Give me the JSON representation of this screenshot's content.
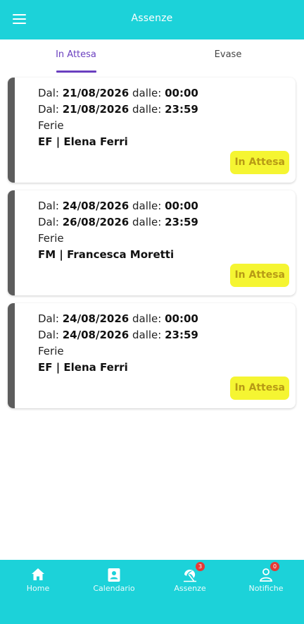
{
  "header": {
    "title": "Assenze"
  },
  "tabs": [
    {
      "label": "In Attesa"
    },
    {
      "label": "Evase"
    }
  ],
  "labels": {
    "dal": "Dal:",
    "dalle": "dalle:"
  },
  "requests": [
    {
      "start_date": "21/08/2026",
      "start_time": "00:00",
      "end_date": "21/08/2026",
      "end_time": "23:59",
      "type": "Ferie",
      "employee": "EF | Elena Ferri",
      "status": "In Attesa"
    },
    {
      "start_date": "24/08/2026",
      "start_time": "00:00",
      "end_date": "26/08/2026",
      "end_time": "23:59",
      "type": "Ferie",
      "employee": "FM | Francesca Moretti",
      "status": "In Attesa"
    },
    {
      "start_date": "24/08/2026",
      "start_time": "00:00",
      "end_date": "24/08/2026",
      "end_time": "23:59",
      "type": "Ferie",
      "employee": "EF | Elena Ferri",
      "status": "In Attesa"
    }
  ],
  "bottom_nav": [
    {
      "label": "Home",
      "icon": "home-icon"
    },
    {
      "label": "Calendario",
      "icon": "calendar-icon"
    },
    {
      "label": "Assenze",
      "icon": "beach-umbrella-icon",
      "badge": "3"
    },
    {
      "label": "Notifiche",
      "icon": "user-icon",
      "badge": "0"
    }
  ],
  "colors": {
    "primary": "#1cd2d9",
    "tab_active": "#6a3fbf",
    "card_border": "#5d5d5d",
    "badge_bg": "#f5f532",
    "badge_text": "#b79a15",
    "notification_badge": "#e53935"
  }
}
